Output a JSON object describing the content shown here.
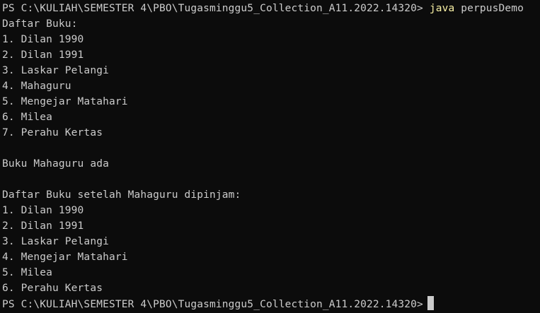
{
  "terminal": {
    "prompt": "PS C:\\KULIAH\\SEMESTER 4\\PBO\\Tugasminggu5_Collection_A11.2022.14320>",
    "command": "java",
    "command_args": "perpusDemo",
    "output": [
      "Daftar Buku:",
      "1. Dilan 1990",
      "2. Dilan 1991",
      "3. Laskar Pelangi",
      "4. Mahaguru",
      "5. Mengejar Matahari",
      "6. Milea",
      "7. Perahu Kertas",
      "",
      "Buku Mahaguru ada",
      "",
      "Daftar Buku setelah Mahaguru dipinjam:",
      "1. Dilan 1990",
      "2. Dilan 1991",
      "3. Laskar Pelangi",
      "4. Mengejar Matahari",
      "5. Milea",
      "6. Perahu Kertas"
    ],
    "final_prompt": "PS C:\\KULIAH\\SEMESTER 4\\PBO\\Tugasminggu5_Collection_A11.2022.14320>",
    "colors": {
      "background": "#0c0c0c",
      "text": "#cccccc",
      "command": "#f9f1a5"
    }
  }
}
